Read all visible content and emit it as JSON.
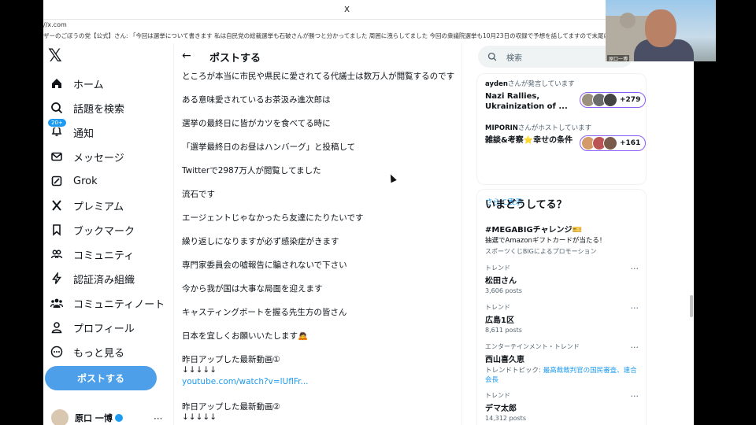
{
  "topbar": {
    "close_label": "x",
    "url": "//x.com",
    "ticker": "ザーのごぼうの党【公式】さん: 「今回は選挙について書きます 私は自民党の総裁選挙も石破さんが勝つと分かってました 周囲に洩らしてました 今回の衆議院選挙も10月23日の収録で予想を話してますので末尾に貼り付けておきます"
  },
  "sidebar": {
    "items": [
      {
        "label": "ホーム"
      },
      {
        "label": "話題を検索"
      },
      {
        "label": "通知",
        "badge": "20+"
      },
      {
        "label": "メッセージ"
      },
      {
        "label": "Grok"
      },
      {
        "label": "プレミアム"
      },
      {
        "label": "ブックマーク"
      },
      {
        "label": "コミュニティ"
      },
      {
        "label": "認証済み組織"
      },
      {
        "label": "コミュニティノート"
      },
      {
        "label": "プロフィール"
      },
      {
        "label": "もっと見る"
      }
    ],
    "post_button": "ポストする",
    "account_name": "原口 一博"
  },
  "feed": {
    "title": "ポストする",
    "lines": [
      "ところが本当に市民や県民に愛されてる代議士は数万人が閲覧するのです",
      "ある意味愛されているお茶汲み進次郎は",
      "選挙の最終日に皆がカツを食べてる時に",
      "「選挙最終日のお昼はハンバーグ」と投稿して",
      "Twitterで2987万人が閲覧してました",
      "流石です",
      "エージェントじゃなかったら友達にたりたいです",
      "繰り返しになりますが必ず感染症がきます",
      "専門家委員会の嘘報告に騙されないで下さい",
      "今から我が国は大事な局面を迎えます",
      "キャスティングボートを握る先生方の皆さん",
      "日本を宜しくお願いいたします🙇"
    ],
    "video1_label": "昨日アップした最新動画①",
    "arrows": "↓↓↓↓↓",
    "video1_link": "youtube.com/watch?v=lUflFr...",
    "video2_label": "昨日アップした最新動画②",
    "arrows2": "↓↓↓↓↓"
  },
  "right": {
    "search_placeholder": "検索",
    "spaces": [
      {
        "host": "ayden",
        "host_suffix": "さんが発言しています",
        "title": "Nazi Rallies, Ukrainization of ...",
        "count": "+279"
      },
      {
        "host": "MIPORIN",
        "host_suffix": "さんがホストしています",
        "title": "雑談&考察⭐幸せの条件",
        "count": "+161"
      }
    ],
    "show_more": "さらに表示",
    "trends_title": "いまどうしてる？",
    "promo": {
      "name": "#MEGABIGチャレンジ🎫",
      "desc": "抽選でAmazonギフトカードが当たる！",
      "sponsor": "スポーツくじBIGによるプロモーション"
    },
    "trends": [
      {
        "cat": "トレンド",
        "name": "松田さん",
        "count": "3,606 posts"
      },
      {
        "cat": "トレンド",
        "name": "広島1区",
        "count": "8,611 posts"
      },
      {
        "cat": "エンターテインメント・トレンド",
        "name": "西山喜久恵",
        "desc_prefix": "トレンドトピック: ",
        "desc_link": "最高裁裁判官の国民審査、連合会長"
      },
      {
        "cat": "トレンド",
        "name": "デマ太郎",
        "count": "14,312 posts"
      }
    ]
  },
  "webcam": {
    "caption": "原口一博"
  },
  "colors": {
    "accent": "#1d9bf0",
    "post_button": "#4c9fe8",
    "space_ring": "#8b5cf6"
  }
}
